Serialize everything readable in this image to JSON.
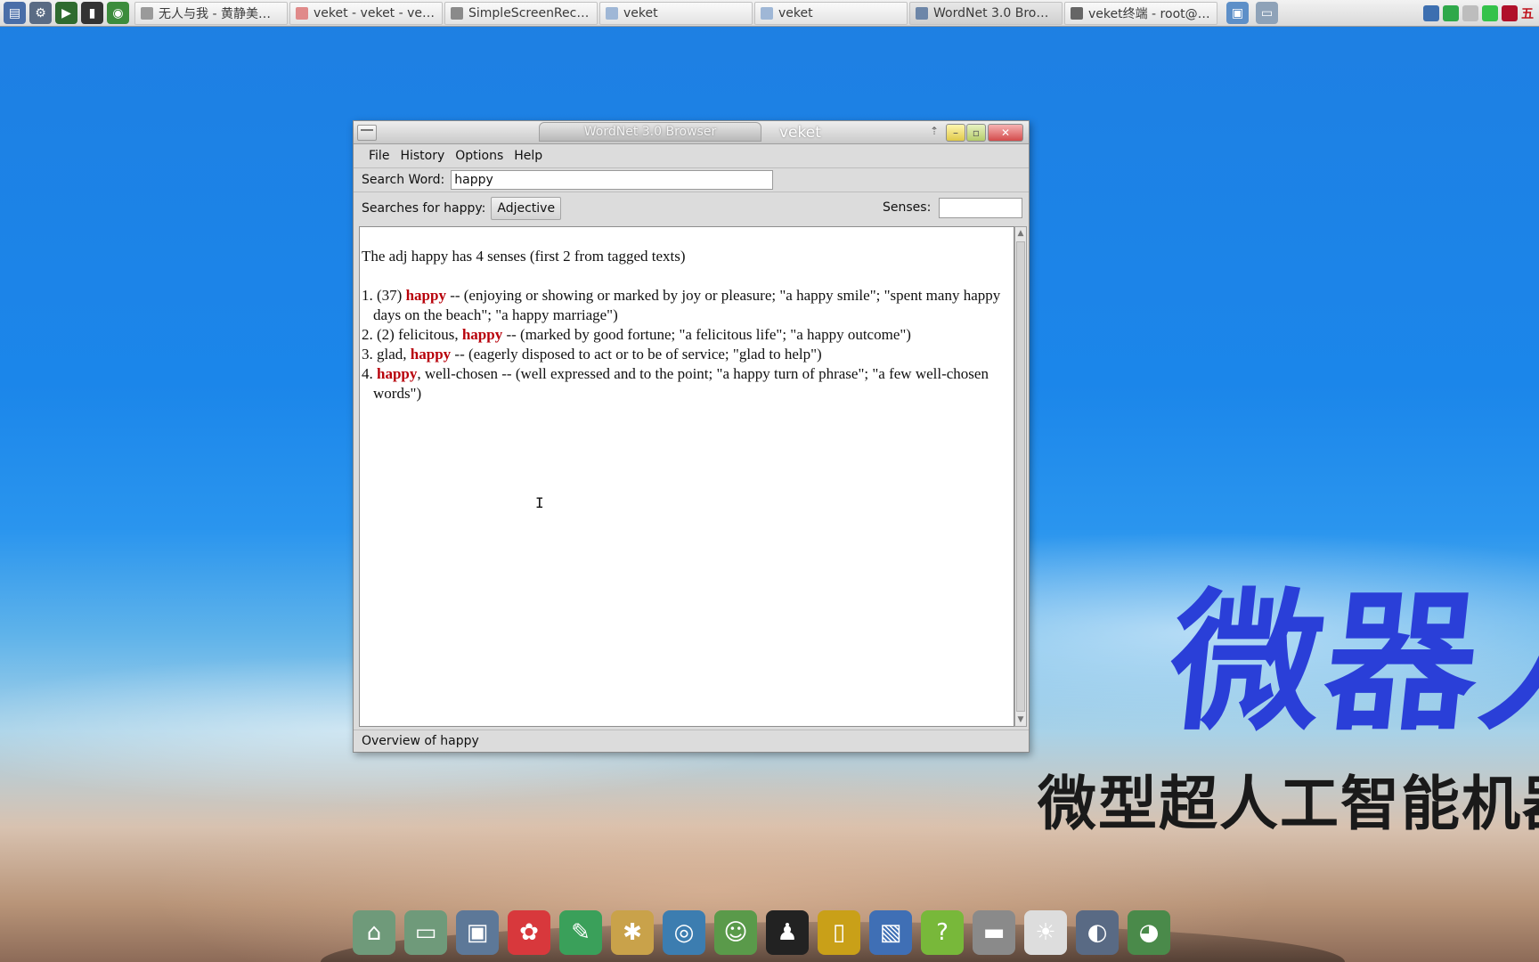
{
  "taskbar": {
    "launchers": [
      {
        "icon": "system-monitor-icon",
        "color": "#4a6ea8"
      },
      {
        "icon": "settings-gears-icon",
        "color": "#5a6b84"
      },
      {
        "icon": "media-play-icon",
        "color": "#2f6b2f"
      },
      {
        "icon": "terminal-icon",
        "color": "#333333"
      },
      {
        "icon": "globe-browser-icon",
        "color": "#3c8c3c"
      }
    ],
    "tasks": [
      {
        "label": "无人与我 - 黄静美…",
        "icon": "media-player-icon",
        "color": "#9a9a9a"
      },
      {
        "label": "veket - veket - ve…",
        "icon": "browser-icon",
        "color": "#e08a8a"
      },
      {
        "label": "SimpleScreenRec…",
        "icon": "screen-recorder-icon",
        "color": "#8a8a8a"
      },
      {
        "label": "veket",
        "icon": "folder-icon",
        "color": "#9fb7d6"
      },
      {
        "label": "veket",
        "icon": "folder-icon",
        "color": "#9fb7d6"
      },
      {
        "label": "WordNet 3.0 Bro…",
        "icon": "window-icon",
        "color": "#6d86a8"
      },
      {
        "label": "veket终端 - root@ …",
        "icon": "terminal-icon",
        "color": "#666666"
      }
    ],
    "tray_ime": "五",
    "tray": [
      {
        "icon": "network-icon",
        "color": "#3d6fb0"
      },
      {
        "icon": "security-shield-icon",
        "color": "#2fa84a"
      },
      {
        "icon": "clipboard-icon",
        "color": "#bdbdbd"
      },
      {
        "icon": "storage-icon",
        "color": "#34c24a"
      },
      {
        "icon": "record-icon",
        "color": "#b0102a"
      }
    ]
  },
  "wallpaper": {
    "title": "微器人",
    "subtitle": "微型超人工智能机器"
  },
  "window": {
    "tab_title": "WordNet 3.0 Browser",
    "app_title": "veket",
    "menu": [
      "File",
      "History",
      "Options",
      "Help"
    ],
    "search_label": "Search Word:",
    "search_value": "happy",
    "searches_label": "Searches for happy:",
    "pos_button": "Adjective",
    "senses_label": "Senses:",
    "senses_value": "",
    "overview": {
      "heading": "The adj happy has 4 senses (first 2 from tagged texts)",
      "senses": [
        {
          "prefix": "1. (37) ",
          "before": "",
          "head": "happy",
          "after": " -- (enjoying or showing or marked by joy or pleasure; \"a happy smile\"; \"spent many happy days on the beach\"; \"a happy marriage\")"
        },
        {
          "prefix": "2. (2) ",
          "before": "felicitous, ",
          "head": "happy",
          "after": " -- (marked by good fortune; \"a felicitous life\"; \"a happy outcome\")"
        },
        {
          "prefix": "3. ",
          "before": "glad, ",
          "head": "happy",
          "after": " -- (eagerly disposed to act or to be of service; \"glad to help\")"
        },
        {
          "prefix": "4. ",
          "before": "",
          "head": "happy",
          "after": ", well-chosen -- (well expressed and to the point; \"a happy turn of phrase\"; \"a few well-chosen words\")"
        }
      ]
    },
    "status": "Overview of happy"
  },
  "dock": [
    {
      "icon": "home-folder-icon",
      "color": "#6f9a7a"
    },
    {
      "icon": "folder-icon",
      "color": "#6f9a7a"
    },
    {
      "icon": "computer-icon",
      "color": "#5d7898"
    },
    {
      "icon": "mascot-icon",
      "color": "#d8383c"
    },
    {
      "icon": "text-editor-icon",
      "color": "#3aa05a"
    },
    {
      "icon": "paint-palette-icon",
      "color": "#c9a24a"
    },
    {
      "icon": "media-player-icon",
      "color": "#3c7db0"
    },
    {
      "icon": "users-network-icon",
      "color": "#5a9a4a"
    },
    {
      "icon": "penguin-chat-icon",
      "color": "#222222"
    },
    {
      "icon": "address-book-icon",
      "color": "#c9a018"
    },
    {
      "icon": "spreadsheet-chart-icon",
      "color": "#3f6fb5"
    },
    {
      "icon": "help-icon",
      "color": "#78b83a"
    },
    {
      "icon": "drive-icon",
      "color": "#8a8a8a"
    },
    {
      "icon": "brightness-icon",
      "color": "#dddddd"
    },
    {
      "icon": "globe-icon",
      "color": "#596a84"
    },
    {
      "icon": "browser-sphere-icon",
      "color": "#4a8a4a"
    }
  ]
}
